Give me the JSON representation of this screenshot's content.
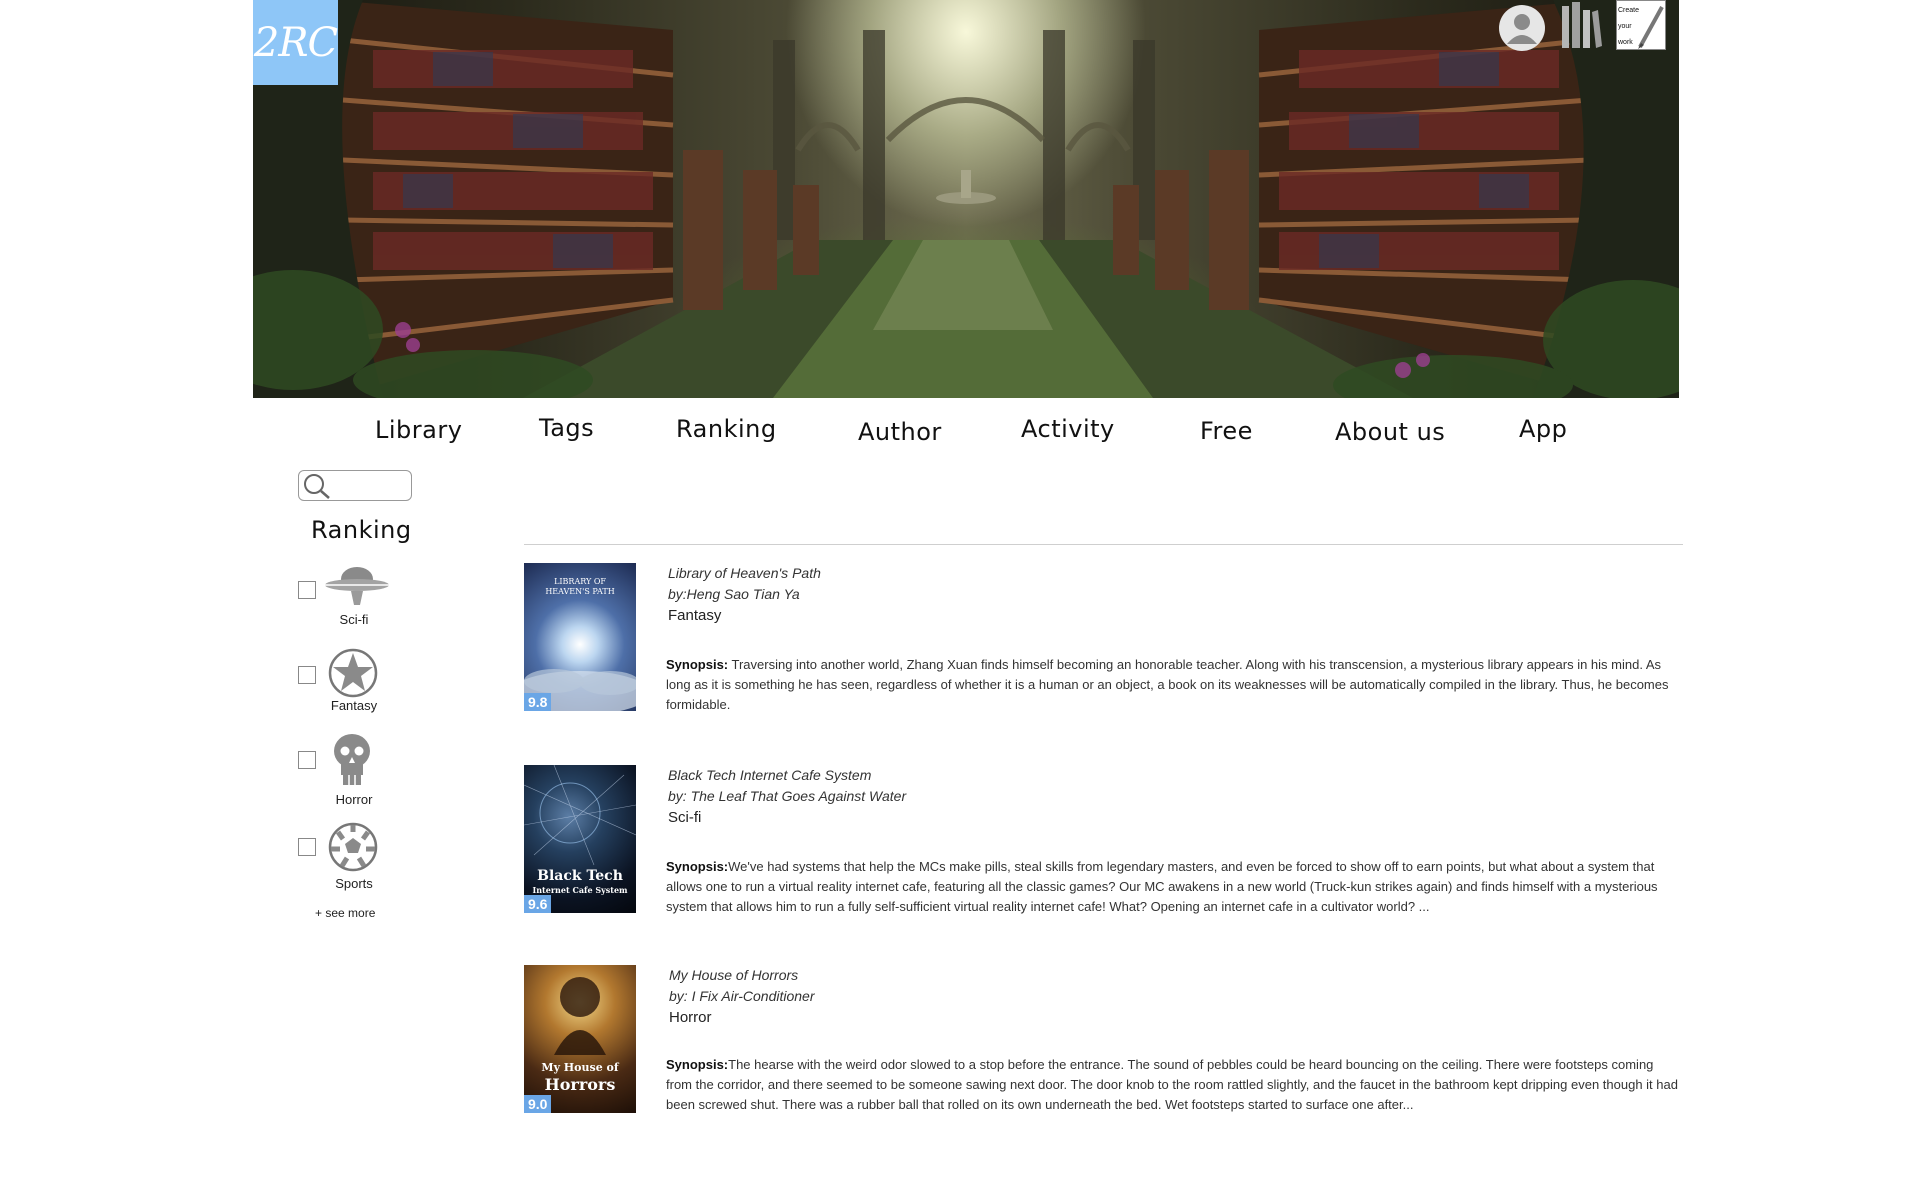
{
  "logo": {
    "text": "2RC"
  },
  "header": {
    "icons": {
      "user": "user-icon",
      "library": "bookshelf-icon",
      "create": "pencil-icon"
    },
    "create_label": "Create your work"
  },
  "nav": {
    "items": [
      "Library",
      "Tags",
      "Ranking",
      "Author",
      "Activity",
      "Free",
      "About us",
      "App"
    ]
  },
  "sidebar": {
    "search": {
      "placeholder": "",
      "value": "",
      "icon": "search-icon"
    },
    "title": "Ranking",
    "genres": [
      {
        "label": "Sci-fi",
        "icon": "ufo-icon",
        "checked": false
      },
      {
        "label": "Fantasy",
        "icon": "star-icon",
        "checked": false
      },
      {
        "label": "Horror",
        "icon": "skull-icon",
        "checked": false
      },
      {
        "label": "Sports",
        "icon": "soccer-ball-icon",
        "checked": false
      }
    ],
    "see_more": "+ see more"
  },
  "books": [
    {
      "title": "Library of Heaven's Path",
      "author": "by:Heng Sao Tian Ya",
      "genre": "Fantasy",
      "rating": "9.8",
      "cover_text": [
        "LIBRARY OF",
        "HEAVEN'S PATH"
      ],
      "synopsis_label": "Synopsis:",
      "synopsis": " Traversing into another world, Zhang Xuan finds himself becoming an honorable teacher. Along with his transcension, a mysterious library appears in his mind. As long as it is something he has seen, regardless of whether it is a human or an object, a book on its weaknesses will be automatically compiled in the library. Thus, he becomes formidable."
    },
    {
      "title": "Black Tech Internet Cafe System",
      "author": "by: The Leaf That Goes Against Water",
      "genre": "Sci-fi",
      "rating": "9.6",
      "cover_text": [
        "Black Tech",
        "Internet Cafe System"
      ],
      "synopsis_label": "Synopsis:",
      "synopsis": "We've had systems that help the MCs make pills, steal skills from legendary masters, and even be forced to show off to earn points, but what about a system that allows one to run a virtual reality internet cafe, featuring all the classic games? Our MC awakens in a new world (Truck-kun strikes again) and finds himself with a mysterious system that allows him to run a fully self-sufficient virtual reality internet cafe! What? Opening an internet cafe in a cultivator world? ..."
    },
    {
      "title": "My House of Horrors",
      "author": "by:  I Fix Air-Conditioner",
      "genre": "Horror",
      "rating": "9.0",
      "cover_text": [
        "My House of",
        "Horrors"
      ],
      "synopsis_label": "Synopsis:",
      "synopsis": "The hearse with the weird odor slowed to a stop before the entrance. The sound of pebbles could be heard bouncing on the ceiling. There were footsteps coming from the corridor, and there seemed to be someone sawing next door. The door knob to the room rattled slightly, and the faucet in the bathroom kept dripping even though it had been screwed shut. There was a rubber ball that rolled on its own underneath the bed. Wet footsteps started to surface one after..."
    }
  ]
}
